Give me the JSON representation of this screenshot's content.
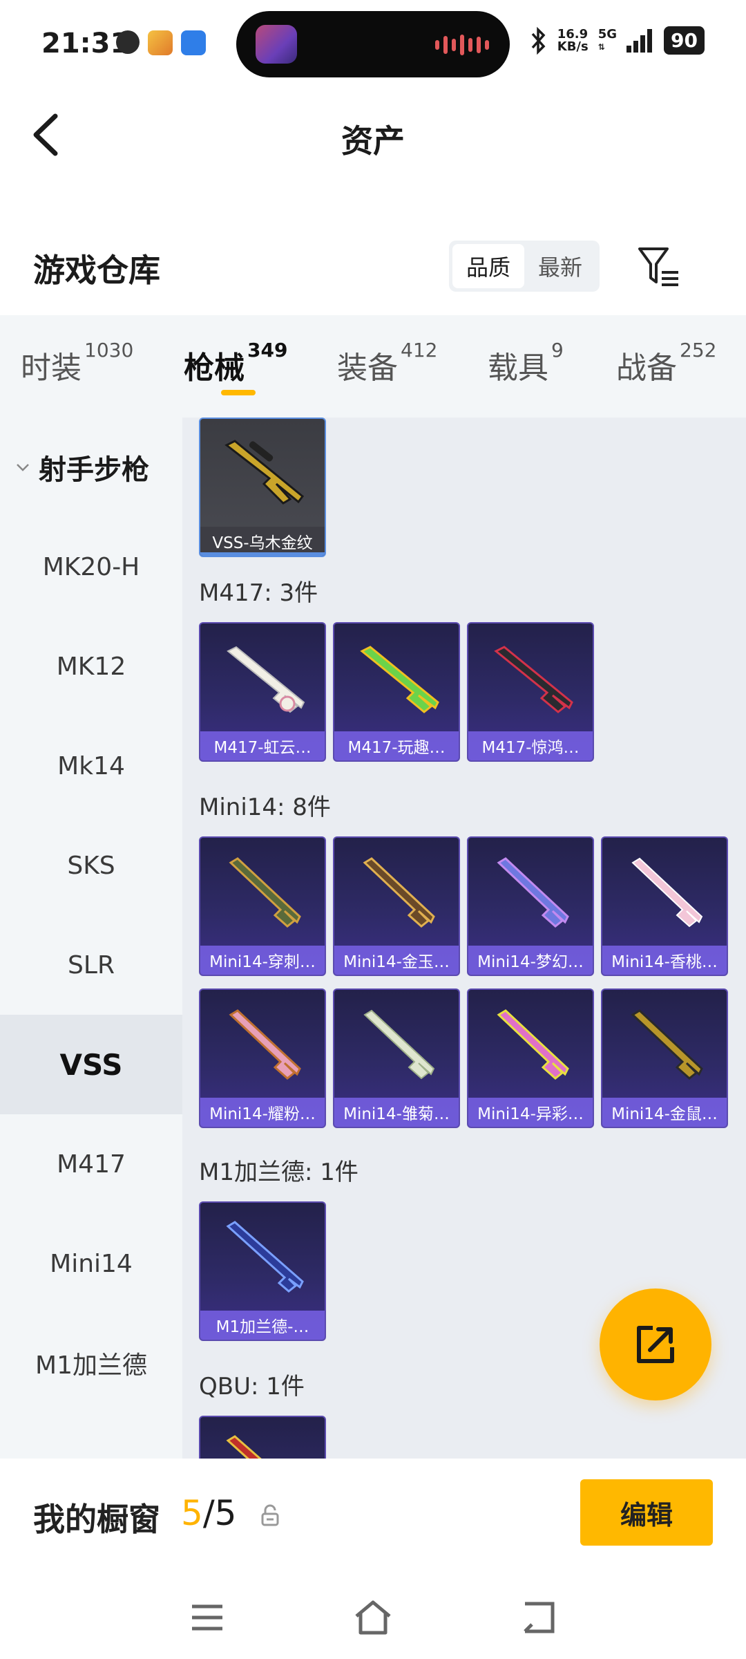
{
  "status_bar": {
    "time": "21:31",
    "net_speed_value": "16.9",
    "net_speed_unit": "KB/s",
    "network": "5G",
    "battery": "90"
  },
  "header": {
    "title": "资产"
  },
  "warehouse": {
    "title": "游戏仓库",
    "sort_options": [
      "品质",
      "最新"
    ],
    "active_sort": "品质"
  },
  "tabs": [
    {
      "label": "时装",
      "count": "1030"
    },
    {
      "label": "枪械",
      "count": "349",
      "active": true
    },
    {
      "label": "装备",
      "count": "412"
    },
    {
      "label": "载具",
      "count": "9"
    },
    {
      "label": "战备",
      "count": "252"
    }
  ],
  "sidebar": {
    "group": "射手步枪",
    "items": [
      "MK20-H",
      "MK12",
      "Mk14",
      "SKS",
      "SLR",
      "VSS",
      "M417",
      "Mini14",
      "M1加兰德"
    ],
    "active": "VSS"
  },
  "sections": [
    {
      "label": "",
      "items": [
        "VSS-乌木金纹"
      ]
    },
    {
      "label": "M417: 3件",
      "items": [
        "M417-虹云…",
        "M417-玩趣…",
        "M417-惊鸿…"
      ]
    },
    {
      "label": "Mini14: 8件",
      "items": [
        "Mini14-穿刺…",
        "Mini14-金玉…",
        "Mini14-梦幻…",
        "Mini14-香桃…",
        "Mini14-耀粉…",
        "Mini14-雏菊…",
        "Mini14-异彩…",
        "Mini14-金鼠…"
      ]
    },
    {
      "label": "M1加兰德: 1件",
      "items": [
        "M1加兰德-…"
      ]
    },
    {
      "label": "QBU: 1件",
      "items": [
        ""
      ]
    }
  ],
  "showcase": {
    "label": "我的橱窗",
    "current": "5",
    "total": "/5",
    "edit_label": "编辑"
  },
  "colors": {
    "accent": "#ffb800",
    "card_purple": "#3c2f86",
    "card_grey": "#4a4b52"
  }
}
